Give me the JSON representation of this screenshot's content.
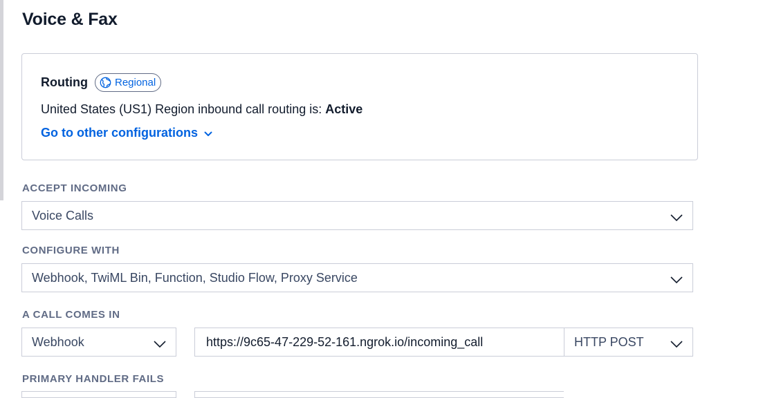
{
  "page": {
    "title": "Voice & Fax"
  },
  "routing": {
    "heading": "Routing",
    "badge_label": "Regional",
    "badge_icon": "globe-icon",
    "status_prefix": "United States (US1) Region inbound call routing is:",
    "status_value": "Active",
    "config_link_label": "Go to other configurations",
    "config_link_icon": "chevron-down-icon"
  },
  "accept_incoming": {
    "label": "ACCEPT INCOMING",
    "value": "Voice Calls"
  },
  "configure_with": {
    "label": "CONFIGURE WITH",
    "value": "Webhook, TwiML Bin, Function, Studio Flow, Proxy Service"
  },
  "call_comes_in": {
    "label": "A CALL COMES IN",
    "type_value": "Webhook",
    "url_value": "https://9c65-47-229-52-161.ngrok.io/incoming_call",
    "method_value": "HTTP POST"
  },
  "primary_handler_fails": {
    "label": "PRIMARY HANDLER FAILS"
  },
  "colors": {
    "link": "#0263e0",
    "label": "#606b85",
    "border": "#cacdd8",
    "text": "#121c2d"
  }
}
